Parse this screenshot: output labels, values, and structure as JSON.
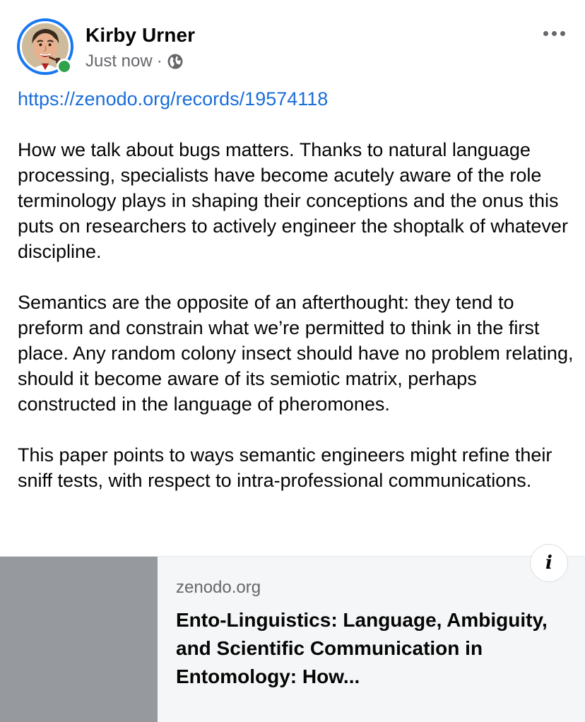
{
  "post": {
    "author": {
      "name": "Kirby Urner",
      "online": true
    },
    "timestamp": "Just now",
    "separator": "·",
    "privacy_icon": "globe-icon",
    "more_icon": "ellipsis-icon",
    "link_url": "https://zenodo.org/records/19574118",
    "paragraphs": [
      "How we talk about bugs matters. Thanks to natural language processing, specialists have become acutely aware of the role terminology plays in shaping their conceptions and the onus this puts on researchers to actively engineer the shoptalk of whatever discipline.",
      "Semantics are the opposite of an afterthought: they tend to preform and constrain what we’re permitted to think in the first place. Any random colony insect should have no problem relating, should it become aware of its semiotic matrix, perhaps constructed in the language of pheromones.",
      "This paper points to ways semantic engineers might refine their sniff tests, with respect to intra-professional communications."
    ],
    "preview": {
      "domain": "zenodo.org",
      "title": "Ento-Linguistics: Language, Ambiguity, and Scientific Communication in Entomology: How...",
      "info_label": "i"
    }
  },
  "colors": {
    "link": "#1a6ed8",
    "online": "#31a24c",
    "avatar_ring": "#1877f2",
    "thumbnail": "#96999e",
    "preview_bg": "#f5f6f7"
  }
}
